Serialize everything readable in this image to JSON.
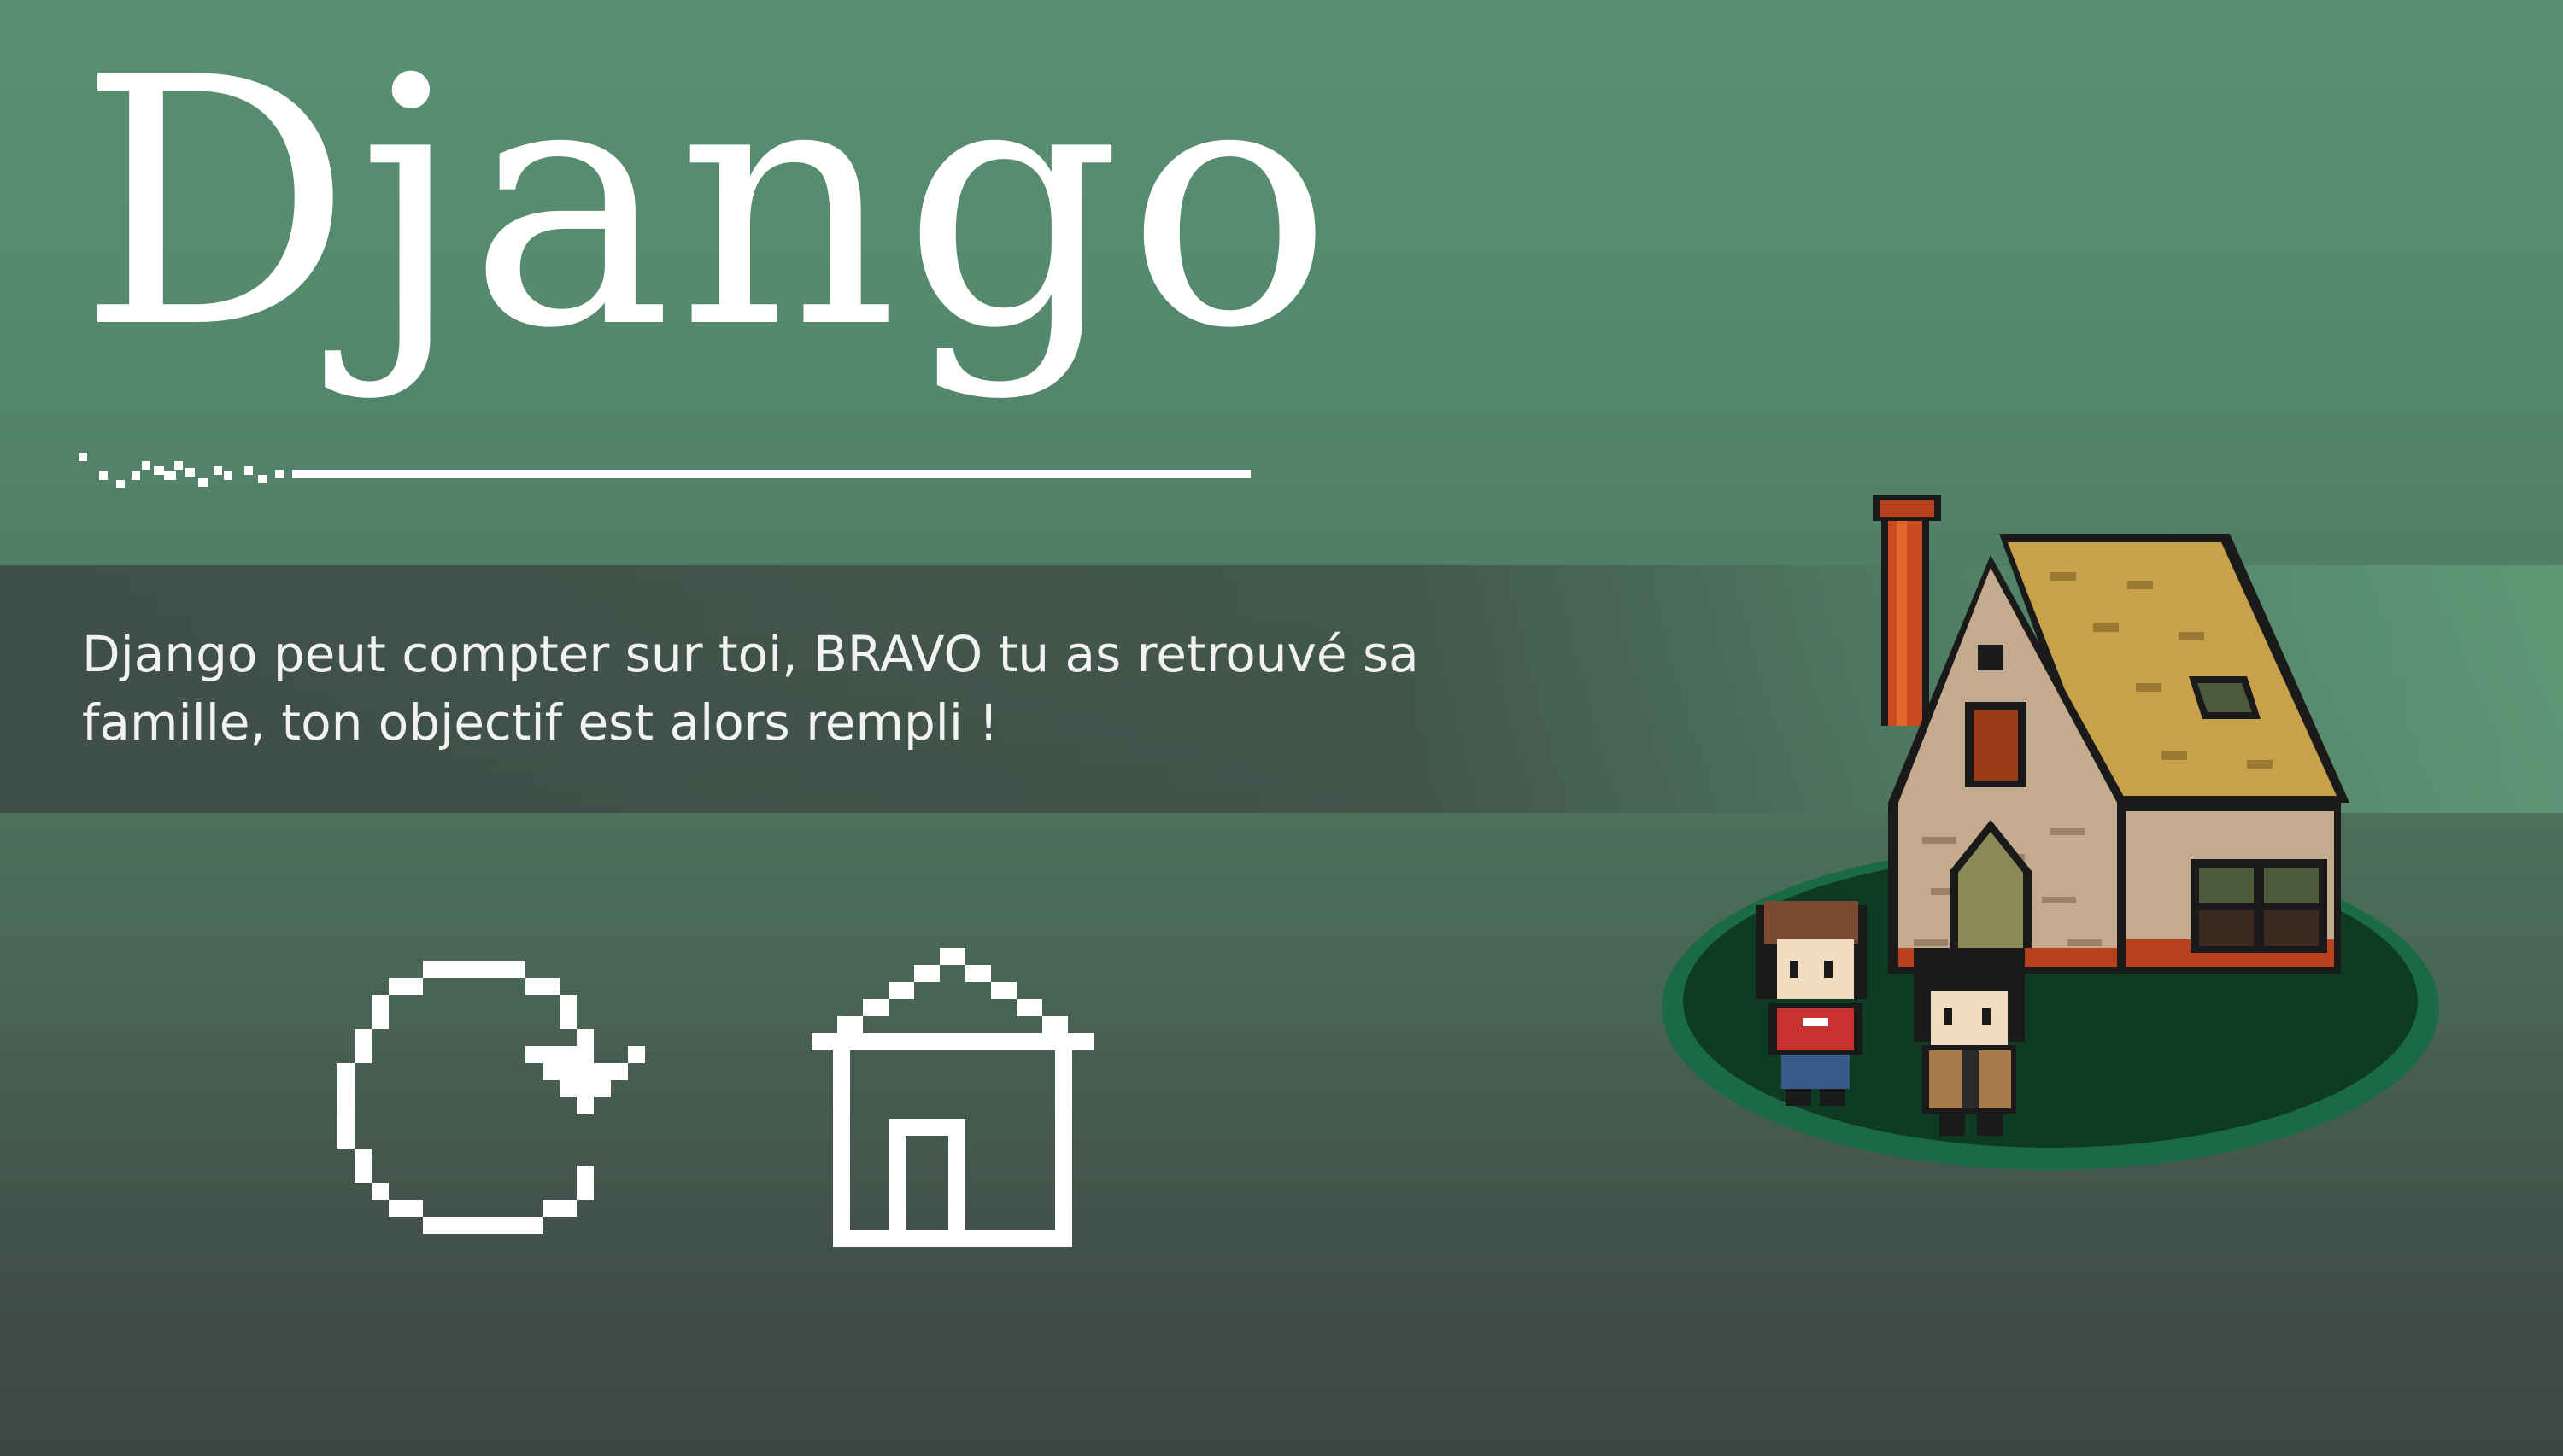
{
  "game": {
    "title": "Django",
    "message": "Django peut compter sur toi, BRAVO tu as retrouvé sa famille, ton objectif est alors rempli !"
  },
  "buttons": {
    "retry_icon": "retry-icon",
    "home_icon": "home-icon"
  },
  "colors": {
    "background_top": "#5a8f72",
    "background_bottom": "#3d4642",
    "text": "#ffffff",
    "banner": "#3e4a44"
  }
}
